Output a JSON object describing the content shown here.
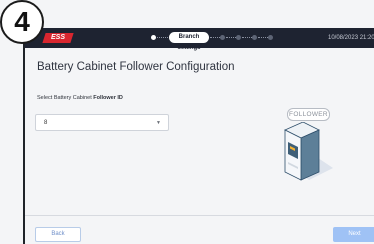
{
  "header": {
    "brand": "ESS",
    "active_step": "Branch settings",
    "datetime": "10/08/2023 21:20",
    "colors": {
      "bar": "#1e2331",
      "brand": "#d8262f"
    }
  },
  "main": {
    "title": "Battery Cabinet Follower Configuration",
    "select_label_prefix": "Select Battery Cabinet ",
    "select_label_bold": "Follower ID",
    "select_value": "8",
    "role_badge": "FOLLOWER",
    "illustration_icon": "battery-cabinet-illustration"
  },
  "footer": {
    "back_label": "Back",
    "next_label": "Next",
    "colors": {
      "primary": "#9fc2f5"
    }
  },
  "annotation": {
    "step_number": "4"
  }
}
